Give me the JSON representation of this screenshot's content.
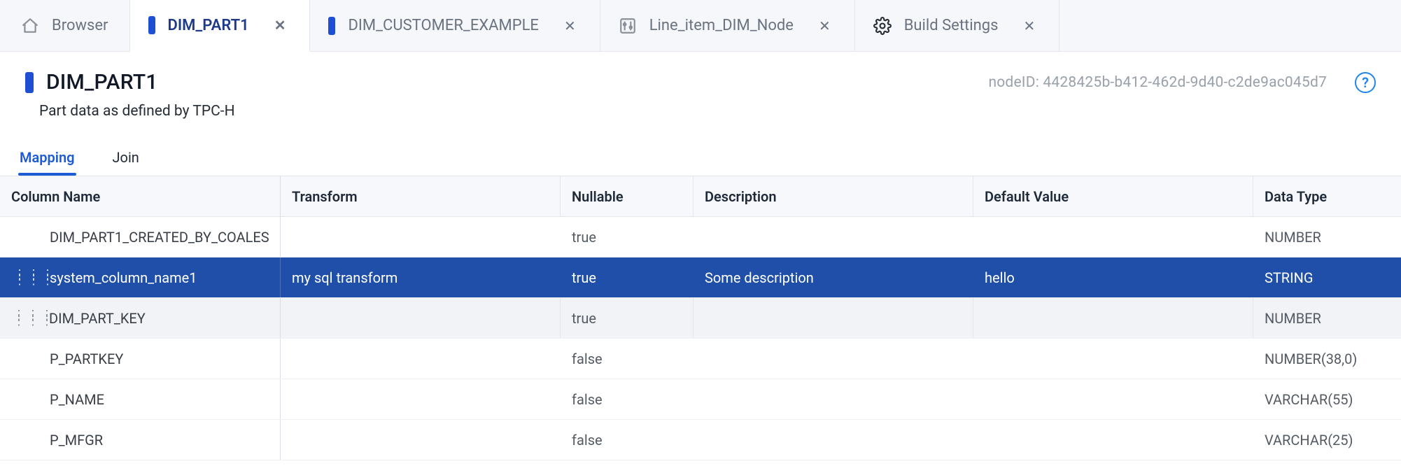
{
  "tabs": {
    "browser": {
      "label": "Browser"
    },
    "items": [
      {
        "label": "DIM_PART1",
        "kind": "chip",
        "active": true
      },
      {
        "label": "DIM_CUSTOMER_EXAMPLE",
        "kind": "chip",
        "active": false
      },
      {
        "label": "Line_item_DIM_Node",
        "kind": "sliders",
        "active": false
      },
      {
        "label": "Build Settings",
        "kind": "gear",
        "active": false
      }
    ]
  },
  "header": {
    "title": "DIM_PART1",
    "subtitle": "Part data as defined by TPC-H",
    "nodeid_label": "nodeID:",
    "nodeid_value": "4428425b-b412-462d-9d40-c2de9ac045d7",
    "help_glyph": "?"
  },
  "subtabs": [
    {
      "label": "Mapping",
      "active": true
    },
    {
      "label": "Join",
      "active": false
    }
  ],
  "table": {
    "headers": {
      "name": "Column Name",
      "transform": "Transform",
      "nullable": "Nullable",
      "description": "Description",
      "default": "Default Value",
      "type": "Data Type"
    },
    "rows": [
      {
        "name": "DIM_PART1_CREATED_BY_COALES",
        "transform": "",
        "nullable": "true",
        "description": "",
        "default": "",
        "type": "NUMBER",
        "state": ""
      },
      {
        "name": "system_column_name1",
        "transform": "my sql transform",
        "nullable": "true",
        "description": "Some description",
        "default": "hello",
        "type": "STRING",
        "state": "selected"
      },
      {
        "name": "DIM_PART_KEY",
        "transform": "",
        "nullable": "true",
        "description": "",
        "default": "",
        "type": "NUMBER",
        "state": "hovered"
      },
      {
        "name": "P_PARTKEY",
        "transform": "",
        "nullable": "false",
        "description": "",
        "default": "",
        "type": "NUMBER(38,0)",
        "state": ""
      },
      {
        "name": "P_NAME",
        "transform": "",
        "nullable": "false",
        "description": "",
        "default": "",
        "type": "VARCHAR(55)",
        "state": ""
      },
      {
        "name": "P_MFGR",
        "transform": "",
        "nullable": "false",
        "description": "",
        "default": "",
        "type": "VARCHAR(25)",
        "state": ""
      }
    ]
  }
}
